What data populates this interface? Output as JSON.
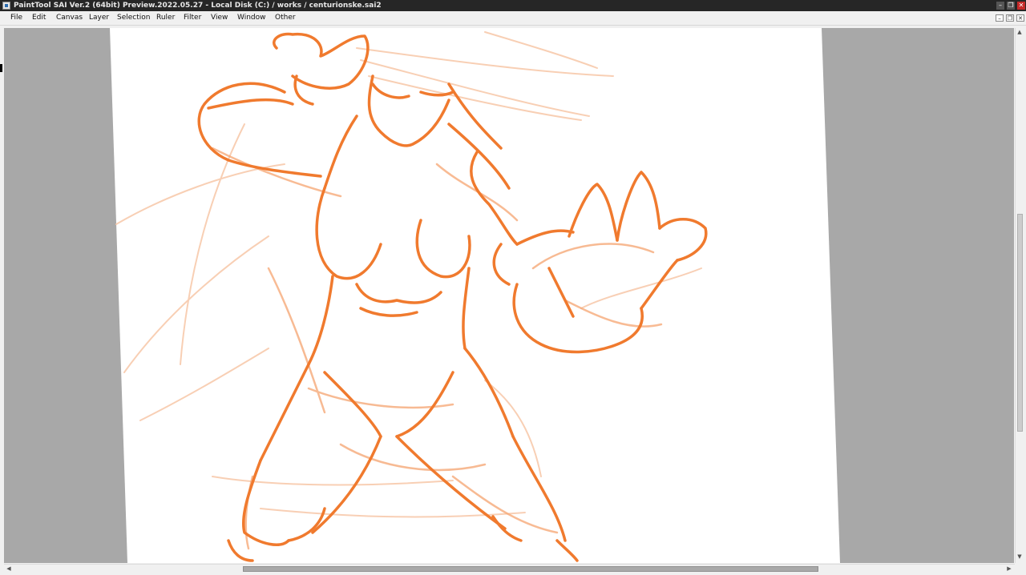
{
  "window": {
    "title": "PaintTool SAI Ver.2 (64bit) Preview.2022.05.27 - Local Disk (C:) / works / centurionske.sai2",
    "min_glyph": "–",
    "max_glyph": "❐",
    "close_glyph": "✕"
  },
  "menu": {
    "items": [
      "File",
      "Edit",
      "Canvas",
      "Layer",
      "Selection",
      "Ruler",
      "Filter",
      "View",
      "Window",
      "Other"
    ],
    "mdi_min": "–",
    "mdi_restore": "❐",
    "mdi_close": "✕"
  },
  "scroll": {
    "up_arrow": "▲",
    "down_arrow": "▼",
    "left_arrow": "◀",
    "right_arrow": "▶",
    "vertical_position": 0.35,
    "horizontal_position": 0.24
  },
  "colors": {
    "sketch_stroke": "#f07a2e",
    "canvas_paper": "#ffffff",
    "workspace_bg": "#a8a8a8",
    "titlebar_bg": "#262626",
    "close_button": "#c62828"
  }
}
